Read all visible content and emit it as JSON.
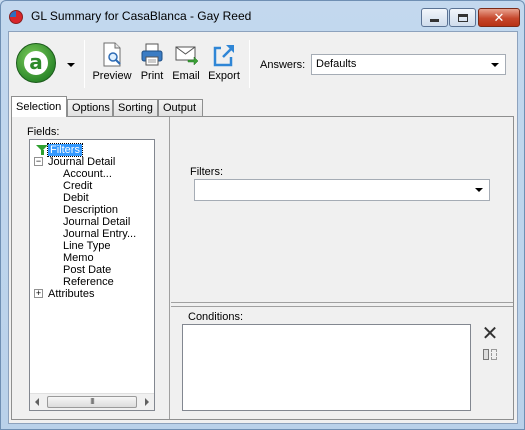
{
  "window": {
    "title": "GL Summary for CasaBlanca - Gay Reed",
    "close_glyph": "✕"
  },
  "toolbar": {
    "logo_letter": "a",
    "preview_label": "Preview",
    "print_label": "Print",
    "email_label": "Email",
    "export_label": "Export",
    "answers_label": "Answers:",
    "answers_value": "Defaults"
  },
  "tabs": [
    {
      "label": "Selection",
      "active": true
    },
    {
      "label": "Options",
      "active": false
    },
    {
      "label": "Sorting",
      "active": false
    },
    {
      "label": "Output",
      "active": false
    }
  ],
  "selection": {
    "fields_label": "Fields:",
    "tree": {
      "filters": "Filters",
      "journal_detail": "Journal Detail",
      "journal_children": [
        "Account...",
        "Credit",
        "Debit",
        "Description",
        "Journal Detail",
        "Journal Entry...",
        "Line Type",
        "Memo",
        "Post Date",
        "Reference"
      ],
      "attributes": "Attributes",
      "collapse_glyph": "−",
      "expand_glyph": "+"
    },
    "scroll_thumb_glyph": "III",
    "filters_label": "Filters:",
    "filters_value": "",
    "conditions_label": "Conditions:",
    "delete_glyph": "✕"
  },
  "colors": {
    "selection_highlight": "#3399ff",
    "logo_green": "#2e8a2b",
    "filter_icon_green": "#2fa02f"
  }
}
